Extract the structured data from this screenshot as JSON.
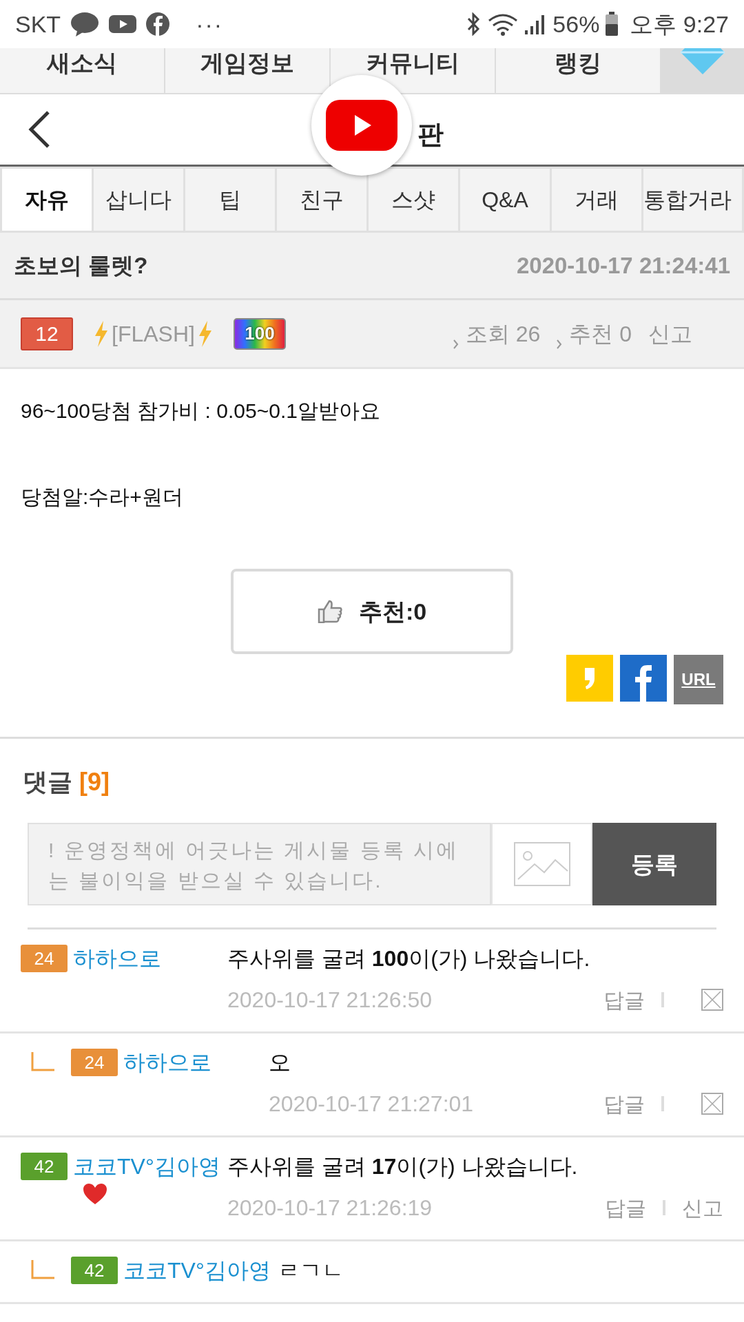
{
  "status_bar": {
    "carrier": "SKT",
    "more": "···",
    "battery": "56%",
    "time": "오후 9:27"
  },
  "top_nav": [
    {
      "label": "새소식"
    },
    {
      "label": "게임정보"
    },
    {
      "label": "커뮤니티"
    },
    {
      "label": "랭킹"
    }
  ],
  "header": {
    "title_visible": "판"
  },
  "board_tabs": [
    {
      "label": "자유",
      "selected": true
    },
    {
      "label": "삽니다",
      "selected": false
    },
    {
      "label": "팁",
      "selected": false
    },
    {
      "label": "친구",
      "selected": false
    },
    {
      "label": "스샷",
      "selected": false
    },
    {
      "label": "Q&A",
      "selected": false
    },
    {
      "label": "거래",
      "selected": false
    },
    {
      "label": "통합거라",
      "selected": false
    }
  ],
  "post": {
    "title": "초보의 룰렛?",
    "datetime": "2020-10-17 21:24:41",
    "author_level": "12",
    "author_name": "[FLASH]",
    "author_badge": "100",
    "views": "조회 26",
    "recommends": "추천 0",
    "report": "신고",
    "body": [
      "96~100당첨 참가비 : 0.05~0.1알받아요",
      "당첨알:수라+원더"
    ],
    "recommend_button": "추천:0",
    "share": [
      {
        "kind": "kakao"
      },
      {
        "kind": "facebook"
      },
      {
        "kind": "url",
        "label": "URL"
      }
    ]
  },
  "comments_section": {
    "heading": "댓글",
    "count": "[9]",
    "input": {
      "placeholder": "! 운영정책에 어긋나는 게시물 등록 시에는 불이익을 받으실 수 있습니다."
    },
    "submit": "등록"
  },
  "comments": [
    {
      "reply": false,
      "level": "24",
      "color": "#e8903a",
      "name": "하하으로",
      "heart": false,
      "text": "주사위를 굴려 **100**이(가) 나왔습니다.",
      "time": "2020-10-17 21:26:50",
      "reply_label": "답글",
      "kind": "delete"
    },
    {
      "reply": true,
      "level": "24",
      "color": "#e8903a",
      "name": "하하으로",
      "heart": false,
      "text": "오",
      "time": "2020-10-17 21:27:01",
      "reply_label": "답글",
      "kind": "delete"
    },
    {
      "reply": false,
      "level": "42",
      "color": "#5aa02c",
      "name": "코코TV°김아영",
      "heart": true,
      "text": "주사위를 굴려 **17**이(가) 나왔습니다.",
      "time": "2020-10-17 21:26:19",
      "reply_label": "답글",
      "kind": "report",
      "report_label": "신고"
    },
    {
      "reply": true,
      "level": "42",
      "color": "#5aa02c",
      "name": "코코TV°김아영",
      "heart": false,
      "text": "ㄹㄱㄴ"
    }
  ]
}
